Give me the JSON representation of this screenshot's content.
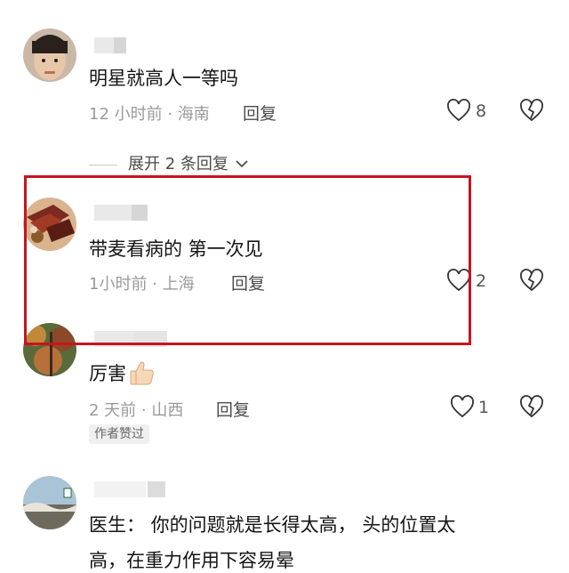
{
  "comments": [
    {
      "text": "明星就高人一等吗",
      "meta": "12 小时前 · 海南",
      "reply": "回复",
      "likes": "8"
    },
    {
      "text": "带麦看病的 第一次见",
      "meta": "1小时前 · 上海",
      "reply": "回复",
      "likes": "2"
    },
    {
      "text": "厉害",
      "emoji": "thumbs-up-icon",
      "meta": "2 天前 · 山西",
      "reply": "回复",
      "likes": "1",
      "badge": "作者赞过"
    },
    {
      "text_line1": "医生： 你的问题就是长得太高， 头的位置太",
      "text_line2": "高，在重力作用下容易晕"
    }
  ],
  "expand_replies": "展开 2 条回复",
  "colors": {
    "highlight_border": "#c8141e",
    "meta_text": "#9a9a9a",
    "body_text": "#141414"
  }
}
